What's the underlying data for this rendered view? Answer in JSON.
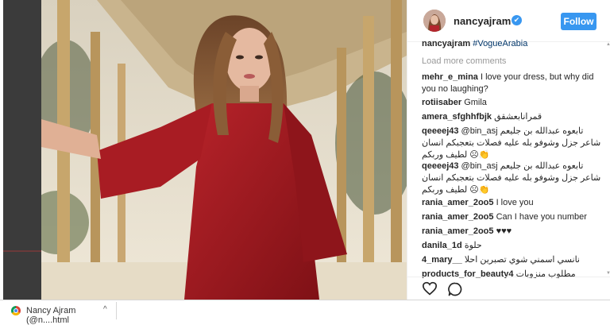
{
  "post": {
    "username": "nancyajram",
    "verified_mark": "✔",
    "follow_label": "Follow"
  },
  "comments": {
    "caption_user": "nancyajram",
    "caption_tag": "#VogueArabia",
    "load_more": "Load more comments",
    "items": [
      {
        "user": "mehr_e_mina",
        "text": "I love your dress, but why did you no laughing?"
      },
      {
        "user": "rotiisaber",
        "text": "Gmila"
      },
      {
        "user": "amera_sfghhfbjk",
        "text": "قمرانابعشقق"
      },
      {
        "user": "qeeeej43",
        "text": "@bin_asj تابعوه عبدالله بن جليعم شاعر جزل وشوفو بله عليه فصلات بتعجبكم انسان لطيف وربكم ☹👏"
      },
      {
        "user": "qeeeej43",
        "text": "@bin_asj تابعوه عبدالله بن جليعم شاعر جزل وشوفو بله عليه فصلات بتعجبكم انسان لطيف وربكم ☹👏"
      },
      {
        "user": "rania_amer_2oo5",
        "text": "I love you"
      },
      {
        "user": "rania_amer_2oo5",
        "text": "Can I have you number"
      },
      {
        "user": "rania_amer_2oo5",
        "text": "♥♥♥"
      },
      {
        "user": "danila_1d",
        "text": "حلوة"
      },
      {
        "user": "4_mary__",
        "text": "نانسي اسمني شوي تصبرين احلا"
      },
      {
        "user": "products_for_beauty4",
        "text": "مطلوب منزوبات"
      }
    ]
  },
  "icons": {
    "heart": "heart-icon",
    "comment": "comment-icon",
    "chrome": "chrome-icon"
  },
  "download_bar": {
    "file_name": "Nancy Ajram (@n....html",
    "chevron": "^"
  }
}
